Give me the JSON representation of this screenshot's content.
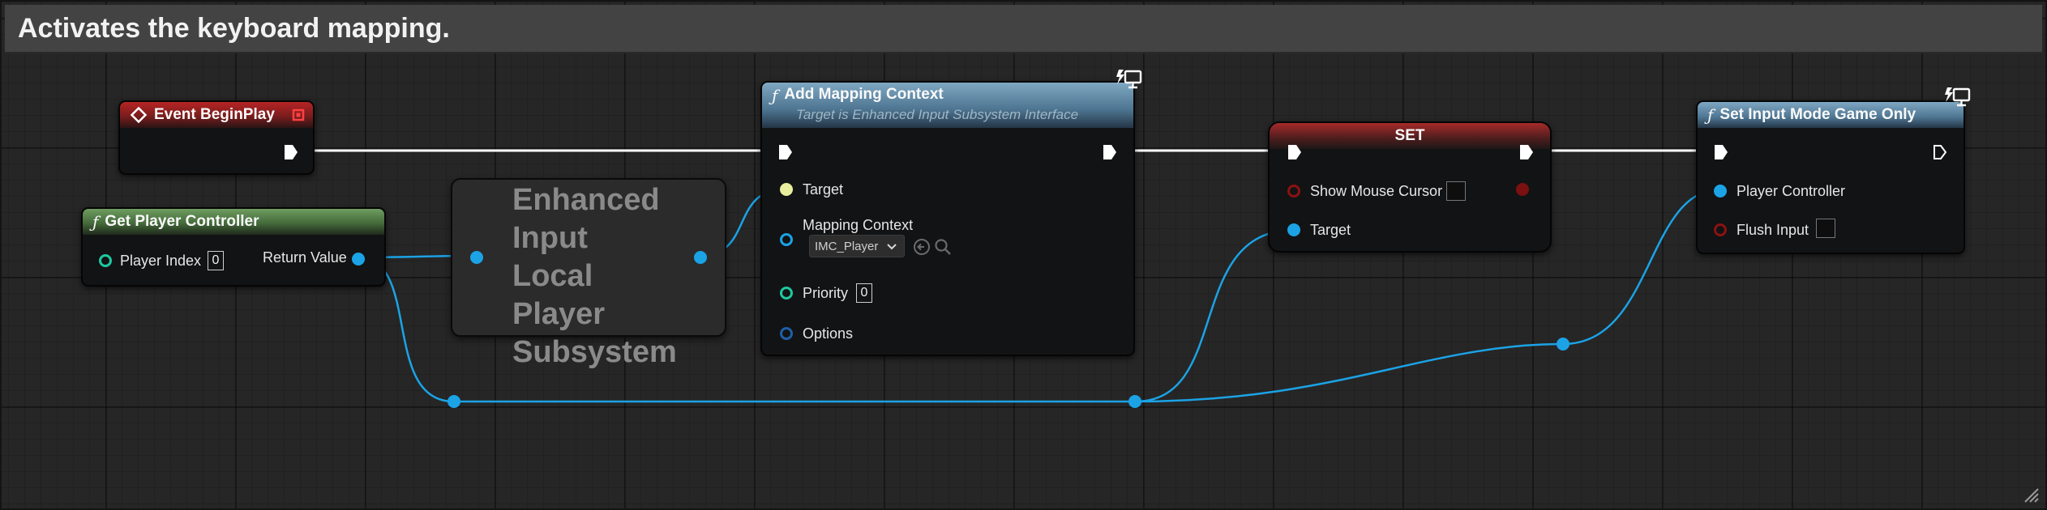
{
  "comment": {
    "title": "Activates the keyboard mapping."
  },
  "nodes": {
    "event_begin_play": {
      "title": "Event BeginPlay"
    },
    "get_player_controller": {
      "title": "Get Player Controller",
      "player_index_label": "Player Index",
      "player_index_value": "0",
      "return_value_label": "Return Value"
    },
    "enhanced_input": {
      "title": "Enhanced Input Local Player Subsystem"
    },
    "add_mapping_context": {
      "title": "Add Mapping Context",
      "subtitle": "Target is Enhanced Input Subsystem Interface",
      "target_label": "Target",
      "mapping_context_label": "Mapping Context",
      "mapping_context_value": "IMC_Player",
      "priority_label": "Priority",
      "priority_value": "0",
      "options_label": "Options"
    },
    "set": {
      "title": "SET",
      "show_mouse_cursor_label": "Show Mouse Cursor",
      "target_label": "Target"
    },
    "set_input_mode": {
      "title": "Set Input Mode Game Only",
      "player_controller_label": "Player Controller",
      "flush_input_label": "Flush Input"
    }
  },
  "colors": {
    "background": "#262626",
    "object_wire": "#1ba3e6",
    "exec_wire": "#ffffff",
    "event_header": "#b62424",
    "pure_header": "#6e9d60",
    "function_header": "#7fa8c3"
  },
  "icons": {
    "event": "diamond-event-icon",
    "function": "function-f-icon",
    "authority": "monitor-icon"
  }
}
